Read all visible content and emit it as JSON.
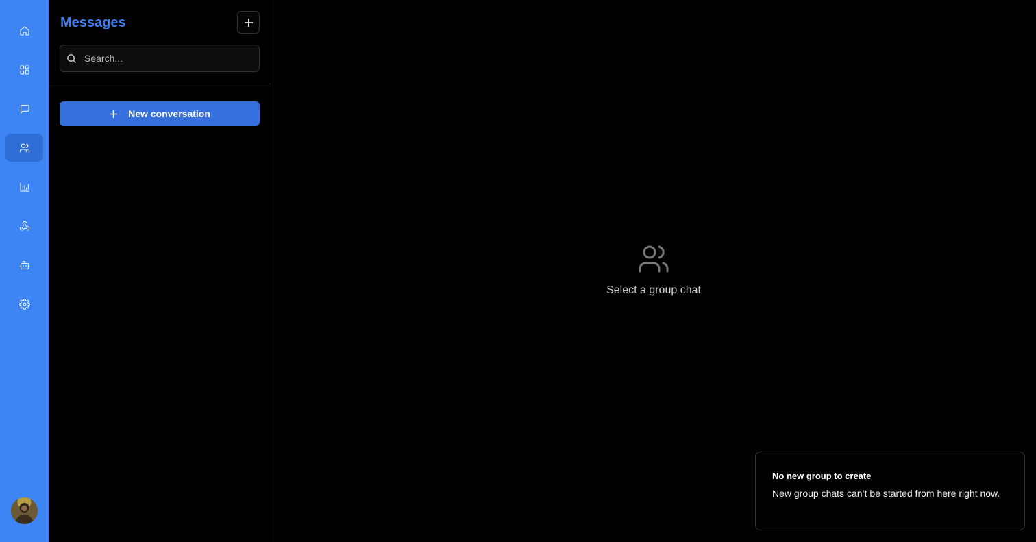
{
  "nav": {
    "items": [
      {
        "icon": "home-icon"
      },
      {
        "icon": "dashboard-icon"
      },
      {
        "icon": "message-icon"
      },
      {
        "icon": "users-icon",
        "active": true
      },
      {
        "icon": "bar-chart-icon"
      },
      {
        "icon": "webhook-icon"
      },
      {
        "icon": "bot-icon"
      },
      {
        "icon": "settings-icon"
      }
    ],
    "avatar": "user-avatar"
  },
  "sidebar": {
    "title": "Messages",
    "search": {
      "placeholder": "Search...",
      "value": ""
    },
    "new_conversation_label": "New conversation"
  },
  "main": {
    "empty_state_text": "Select a group chat"
  },
  "toast": {
    "title": "No new group to create",
    "body": "New group chats can’t be started from here right now."
  },
  "colors": {
    "rail": "#3d85f5",
    "accent": "#3570de",
    "background": "#000000"
  }
}
